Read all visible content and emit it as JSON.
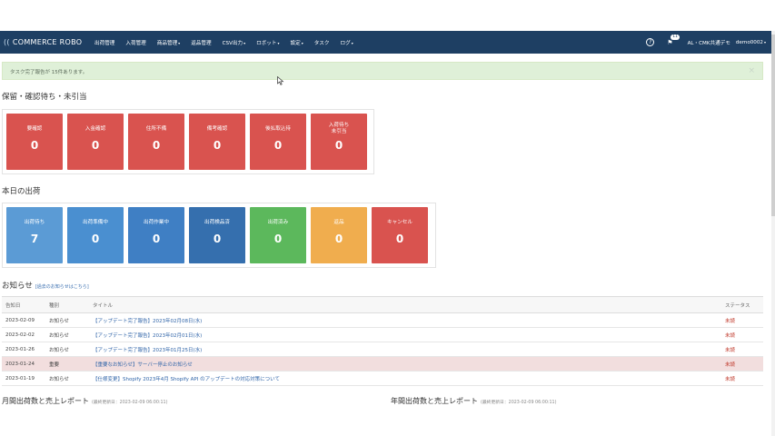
{
  "navbar": {
    "brand": "COMMERCE ROBO",
    "brand_mark": "((",
    "items": [
      {
        "label": "出荷管理",
        "caret": ""
      },
      {
        "label": "入荷管理",
        "caret": ""
      },
      {
        "label": "商品管理",
        "caret": "▾"
      },
      {
        "label": "返品管理",
        "caret": ""
      },
      {
        "label": "CSV出力",
        "caret": "▾"
      },
      {
        "label": "ロボット",
        "caret": "▾"
      },
      {
        "label": "設定",
        "caret": "▾"
      },
      {
        "label": "タスク",
        "caret": ""
      },
      {
        "label": "ログ",
        "caret": "▾"
      }
    ],
    "help_icon": "?",
    "bell_icon": "🔔",
    "notification_count": "11",
    "company": "AL・CMK共通デモ",
    "user": "demo0002",
    "user_caret": "▾"
  },
  "alert": {
    "message": "タスク完了報告が 15件あります。",
    "close": "×"
  },
  "pending": {
    "heading": "保留・確認待ち・未引当",
    "tiles": [
      {
        "label": "要確認",
        "value": "0",
        "color": "#d9534f"
      },
      {
        "label": "入金確認",
        "value": "0",
        "color": "#d9534f"
      },
      {
        "label": "住所不備",
        "value": "0",
        "color": "#d9534f"
      },
      {
        "label": "備考確認",
        "value": "0",
        "color": "#d9534f"
      },
      {
        "label": "後払取込待",
        "value": "0",
        "color": "#d9534f"
      },
      {
        "label": "入荷待ち\n未引当",
        "value": "0",
        "color": "#d9534f"
      }
    ]
  },
  "shipping": {
    "heading": "本日の出荷",
    "tiles": [
      {
        "label": "出荷待ち",
        "value": "7",
        "color": "#5b9bd5"
      },
      {
        "label": "出荷準備中",
        "value": "0",
        "color": "#4a8fd0"
      },
      {
        "label": "出荷作業中",
        "value": "0",
        "color": "#3f7fc4"
      },
      {
        "label": "出荷検品済",
        "value": "0",
        "color": "#356fae"
      },
      {
        "label": "出荷済み",
        "value": "0",
        "color": "#5cb85c"
      },
      {
        "label": "返品",
        "value": "0",
        "color": "#f0ad4e"
      },
      {
        "label": "キャンセル",
        "value": "0",
        "color": "#d9534f"
      }
    ]
  },
  "news": {
    "heading": "お知らせ",
    "past_link": "[過去のお知らせはこちら]",
    "columns": [
      "告知日",
      "種別",
      "タイトル",
      "ステータス"
    ],
    "rows": [
      {
        "date": "2023-02-09",
        "type": "お知らせ",
        "title": "【アップデート完了報告】2023年02月08日(水)",
        "status": "未読",
        "important": false
      },
      {
        "date": "2023-02-02",
        "type": "お知らせ",
        "title": "【アップデート完了報告】2023年02月01日(水)",
        "status": "未読",
        "important": false
      },
      {
        "date": "2023-01-26",
        "type": "お知らせ",
        "title": "【アップデート完了報告】2023年01月25日(水)",
        "status": "未読",
        "important": false
      },
      {
        "date": "2023-01-24",
        "type": "重要",
        "title": "【重要なお知らせ】サーバー停止のお知らせ",
        "status": "未読",
        "important": true
      },
      {
        "date": "2023-01-19",
        "type": "お知らせ",
        "title": "【仕様変更】Shopify 2023年4月 Shopify API のアップデートの対応対策について",
        "status": "未読",
        "important": false
      }
    ]
  },
  "reports": {
    "monthly_title": "月間出荷数と売上レポート",
    "monthly_updated": "(最終更新日：2023-02-09 06:00:11)",
    "yearly_title": "年間出荷数と売上レポート",
    "yearly_updated": "(最終更新日：2023-02-09 06:00:11)"
  }
}
